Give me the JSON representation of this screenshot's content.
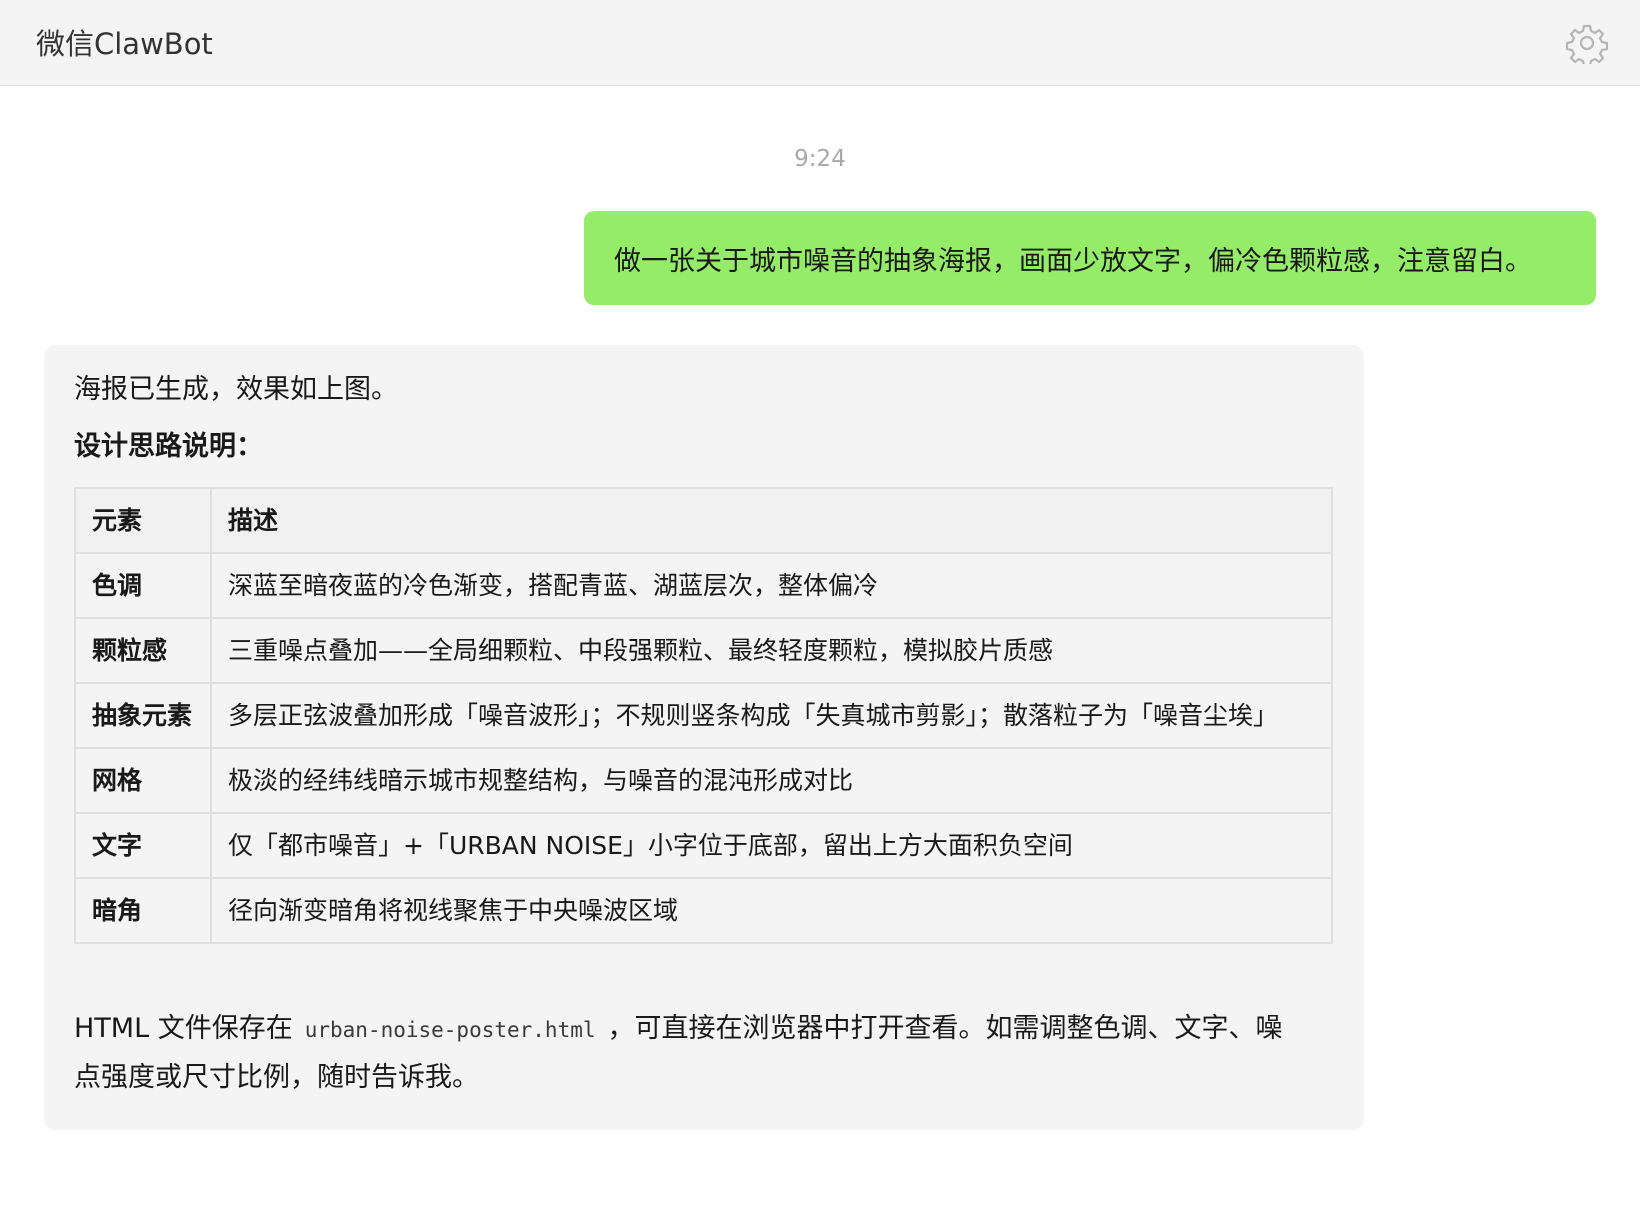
{
  "header": {
    "title": "微信ClawBot",
    "settings_icon": "gear-icon"
  },
  "chat": {
    "timestamp": "9:24",
    "user_message": "做一张关于城市噪音的抽象海报，画面少放文字，偏冷色颗粒感，注意留白。",
    "bot_reply": {
      "intro": "海报已生成，效果如上图。",
      "heading": "设计思路说明：",
      "table": {
        "headers": [
          "元素",
          "描述"
        ],
        "rows": [
          [
            "色调",
            "深蓝至暗夜蓝的冷色渐变，搭配青蓝、湖蓝层次，整体偏冷"
          ],
          [
            "颗粒感",
            "三重噪点叠加——全局细颗粒、中段强颗粒、最终轻度颗粒，模拟胶片质感"
          ],
          [
            "抽象元素",
            "多层正弦波叠加形成「噪音波形」；不规则竖条构成「失真城市剪影」；散落粒子为「噪音尘埃」"
          ],
          [
            "网格",
            "极淡的经纬线暗示城市规整结构，与噪音的混沌形成对比"
          ],
          [
            "文字",
            "仅「都市噪音」+「URBAN NOISE」小字位于底部，留出上方大面积负空间"
          ],
          [
            "暗角",
            "径向渐变暗角将视线聚焦于中央噪波区域"
          ]
        ]
      },
      "outro_before": "HTML 文件保存在",
      "file_name": "urban-noise-poster.html",
      "outro_after": "，可直接在浏览器中打开查看。如需调整色调、文字、噪点强度或尺寸比例，随时告诉我。"
    }
  },
  "colors": {
    "topbar_bg": "#f4f4f4",
    "user_bubble": "#95ec69",
    "bot_bubble": "#f4f4f4",
    "timestamp": "#a8a8a8"
  }
}
